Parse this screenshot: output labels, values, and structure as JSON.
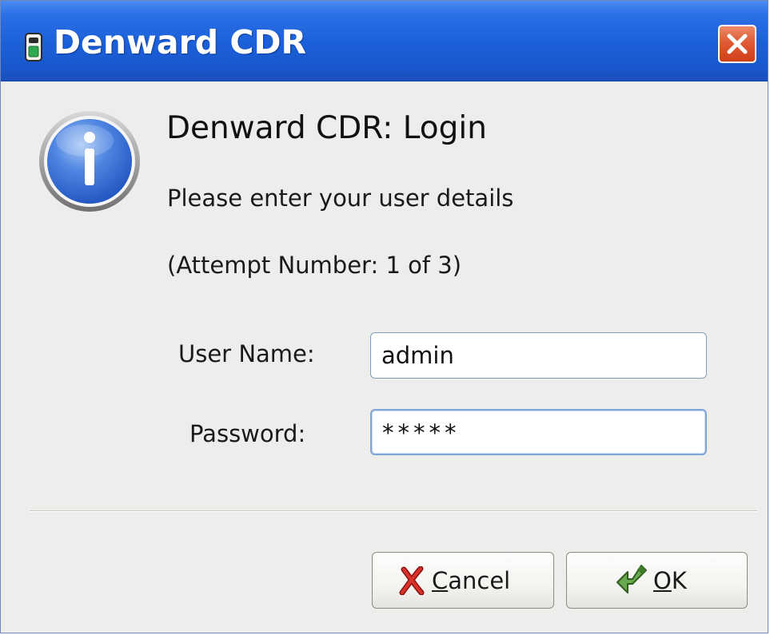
{
  "window": {
    "title": "Denward CDR"
  },
  "dialog": {
    "heading": "Denward CDR: Login",
    "message": "Please enter your user details",
    "attempt_text": "(Attempt Number: 1 of 3)"
  },
  "form": {
    "username_label": "User Name:",
    "username_value": "admin",
    "password_label": "Password:",
    "password_masked": "*****"
  },
  "buttons": {
    "cancel_mnemonic": "C",
    "cancel_rest": "ancel",
    "ok_mnemonic": "O",
    "ok_rest": "K"
  },
  "icons": {
    "title": "lock-icon",
    "close": "close-icon",
    "info": "info-icon",
    "cancel": "red-x-icon",
    "ok": "green-arrow-icon"
  },
  "colors": {
    "titlebar": "#1b5fd8",
    "close_button": "#e05a33",
    "dialog_background": "#ededeb",
    "info_icon": "#3f74d6"
  }
}
